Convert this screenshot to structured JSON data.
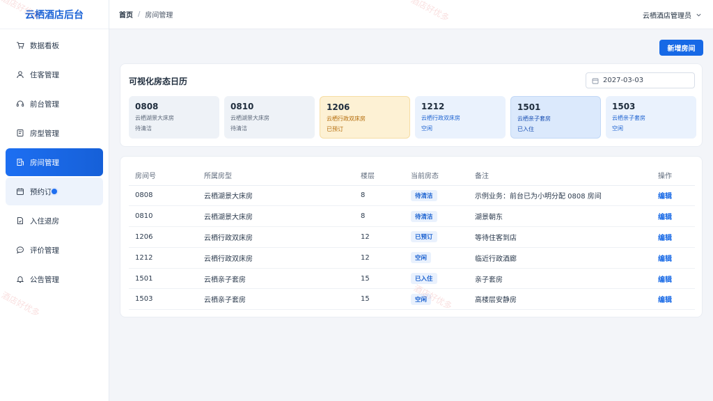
{
  "app": {
    "title": "云栖酒店后台"
  },
  "sidebar": {
    "items": [
      {
        "label": "数据看板",
        "icon": "cart-icon"
      },
      {
        "label": "住客管理",
        "icon": "user-icon"
      },
      {
        "label": "前台管理",
        "icon": "headset-icon"
      },
      {
        "label": "房型管理",
        "icon": "card-icon"
      },
      {
        "label": "房间管理",
        "icon": "building-icon"
      },
      {
        "label": "预约订",
        "icon": "calendar-icon"
      },
      {
        "label": "入住退房",
        "icon": "document-icon"
      },
      {
        "label": "评价管理",
        "icon": "chat-icon"
      },
      {
        "label": "公告管理",
        "icon": "bell-icon"
      }
    ]
  },
  "header": {
    "breadcrumb_home": "首页",
    "breadcrumb_sep": "/",
    "breadcrumb_current": "房间管理",
    "user": "云栖酒店管理员"
  },
  "toolbar": {
    "new_room": "新增房间"
  },
  "calendar": {
    "title": "可视化房态日历",
    "date": "2027-03-03",
    "rooms": [
      {
        "number": "0808",
        "type": "云栖湖景大床房",
        "status": "待清洁"
      },
      {
        "number": "0810",
        "type": "云栖湖景大床房",
        "status": "待清洁"
      },
      {
        "number": "1206",
        "type": "云栖行政双床房",
        "status": "已预订"
      },
      {
        "number": "1212",
        "type": "云栖行政双床房",
        "status": "空闲"
      },
      {
        "number": "1501",
        "type": "云栖亲子套房",
        "status": "已入住"
      },
      {
        "number": "1503",
        "type": "云栖亲子套房",
        "status": "空闲"
      }
    ]
  },
  "table": {
    "headers": [
      "房间号",
      "所属房型",
      "楼层",
      "当前房态",
      "备注",
      "操作"
    ],
    "rows": [
      {
        "number": "0808",
        "type": "云栖湖景大床房",
        "floor": "8",
        "status": "待清洁",
        "note": "示例业务：前台已为小明分配 0808 房间",
        "action": "编辑"
      },
      {
        "number": "0810",
        "type": "云栖湖景大床房",
        "floor": "8",
        "status": "待清洁",
        "note": "湖景朝东",
        "action": "编辑"
      },
      {
        "number": "1206",
        "type": "云栖行政双床房",
        "floor": "12",
        "status": "已预订",
        "note": "等待住客到店",
        "action": "编辑"
      },
      {
        "number": "1212",
        "type": "云栖行政双床房",
        "floor": "12",
        "status": "空闲",
        "note": "临近行政酒廊",
        "action": "编辑"
      },
      {
        "number": "1501",
        "type": "云栖亲子套房",
        "floor": "15",
        "status": "已入住",
        "note": "亲子套房",
        "action": "编辑"
      },
      {
        "number": "1503",
        "type": "云栖亲子套房",
        "floor": "15",
        "status": "空闲",
        "note": "高楼层安静房",
        "action": "编辑"
      }
    ]
  },
  "watermark": "酒店好优多",
  "colors": {
    "primary": "#1769e6",
    "booked": "#b46b09"
  }
}
